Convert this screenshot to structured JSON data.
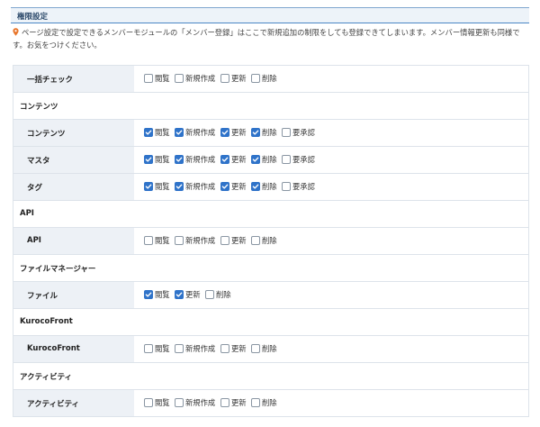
{
  "header": {
    "title": "権限設定"
  },
  "notice": {
    "text": "ページ設定で設定できるメンバーモジュールの「メンバー登録」はここで新規追加の制限をしても登録できてしまいます。メンバー情報更新も同様です。お気をつけください。"
  },
  "labels": {
    "view": "閲覧",
    "new": "新規作成",
    "update": "更新",
    "delete": "削除",
    "approve": "要承認"
  },
  "rows": [
    {
      "kind": "perm",
      "name": "一括チェック",
      "checks": [
        [
          "view",
          false
        ],
        [
          "new",
          false
        ],
        [
          "update",
          false
        ],
        [
          "delete",
          false
        ]
      ]
    },
    {
      "kind": "section",
      "name": "コンテンツ"
    },
    {
      "kind": "perm",
      "name": "コンテンツ",
      "checks": [
        [
          "view",
          true
        ],
        [
          "new",
          true
        ],
        [
          "update",
          true
        ],
        [
          "delete",
          true
        ],
        [
          "approve",
          false
        ]
      ]
    },
    {
      "kind": "perm",
      "name": "マスタ",
      "checks": [
        [
          "view",
          true
        ],
        [
          "new",
          true
        ],
        [
          "update",
          true
        ],
        [
          "delete",
          true
        ],
        [
          "approve",
          false
        ]
      ]
    },
    {
      "kind": "perm",
      "name": "タグ",
      "checks": [
        [
          "view",
          true
        ],
        [
          "new",
          true
        ],
        [
          "update",
          true
        ],
        [
          "delete",
          true
        ],
        [
          "approve",
          false
        ]
      ]
    },
    {
      "kind": "section",
      "name": "API"
    },
    {
      "kind": "perm",
      "name": "API",
      "checks": [
        [
          "view",
          false
        ],
        [
          "new",
          false
        ],
        [
          "update",
          false
        ],
        [
          "delete",
          false
        ]
      ]
    },
    {
      "kind": "section",
      "name": "ファイルマネージャー"
    },
    {
      "kind": "perm",
      "name": "ファイル",
      "checks": [
        [
          "view",
          true
        ],
        [
          "update",
          true
        ],
        [
          "delete",
          false
        ]
      ]
    },
    {
      "kind": "section",
      "name": "KurocoFront"
    },
    {
      "kind": "perm",
      "name": "KurocoFront",
      "checks": [
        [
          "view",
          false
        ],
        [
          "new",
          false
        ],
        [
          "update",
          false
        ],
        [
          "delete",
          false
        ]
      ]
    },
    {
      "kind": "section",
      "name": "アクティビティ"
    },
    {
      "kind": "perm",
      "name": "アクティビティ",
      "checks": [
        [
          "view",
          false
        ],
        [
          "new",
          false
        ],
        [
          "update",
          false
        ],
        [
          "delete",
          false
        ]
      ]
    }
  ],
  "colors": {
    "accent": "#2f73c9",
    "label_bg": "#edf1f6",
    "header_bg": "#edf3f9"
  },
  "icons": {
    "notice": "map-pin-icon",
    "checked": "checkmark-icon"
  }
}
